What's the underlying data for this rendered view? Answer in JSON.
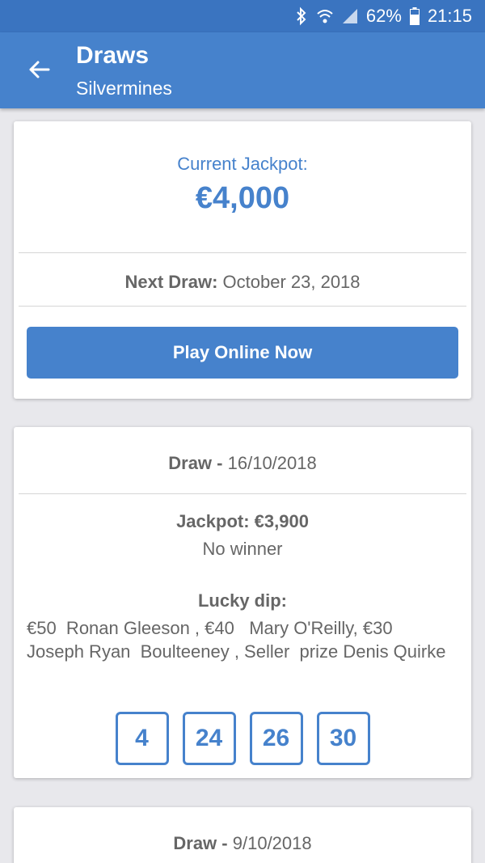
{
  "status_bar": {
    "battery": "62%",
    "time": "21:15",
    "icons": [
      "bluetooth-icon",
      "wifi-icon",
      "signal-icon",
      "battery-icon"
    ]
  },
  "app_bar": {
    "title": "Draws",
    "subtitle": "Silvermines"
  },
  "jackpot_card": {
    "label": "Current Jackpot:",
    "amount": "€4,000",
    "next_draw_label": "Next Draw:",
    "next_draw_date": "October 23, 2018",
    "play_button": "Play Online Now"
  },
  "draws": [
    {
      "label": "Draw -",
      "date": "16/10/2018",
      "jackpot": "Jackpot: €3,900",
      "result": "No winner",
      "lucky_dip_label": "Lucky dip:",
      "lucky_dip_text": "€50  Ronan Gleeson , €40   Mary O'Reilly, €30 Joseph Ryan  Boulteeney , Seller  prize Denis Quirke",
      "numbers": [
        "4",
        "24",
        "26",
        "30"
      ]
    },
    {
      "label": "Draw -",
      "date": "9/10/2018"
    }
  ],
  "colors": {
    "primary": "#4682cc",
    "status_bar": "#3a74c0",
    "background": "#e8e8ec"
  }
}
